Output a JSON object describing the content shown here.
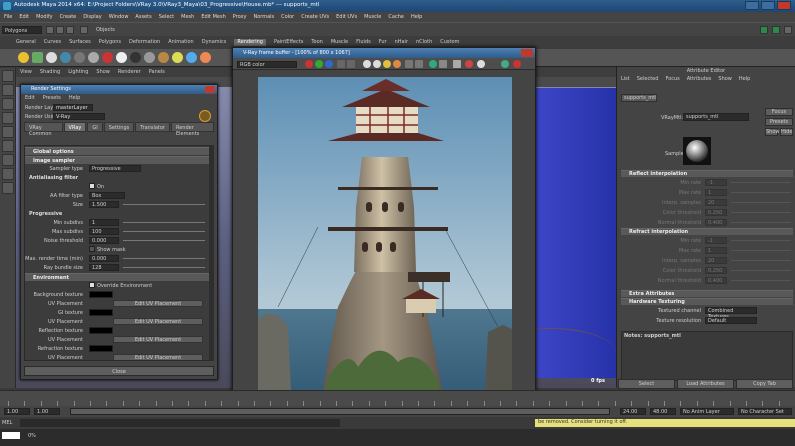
{
  "window": {
    "title": "Autodesk Maya 2014 x64: E:\\Project Folders\\VRay 3.0\\VRay3_Maya\\03_Progressive\\House.mb*  ---  supports_mtl"
  },
  "menubar": [
    "File",
    "Edit",
    "Modify",
    "Create",
    "Display",
    "Window",
    "Assets",
    "Select",
    "Mesh",
    "Edit Mesh",
    "Proxy",
    "Normals",
    "Color",
    "Create UVs",
    "Edit UVs",
    "Muscle",
    "Cache",
    "Help"
  ],
  "statusline": {
    "mode": "Polygons",
    "objects_label": "Objects"
  },
  "shelf_tabs": [
    "General",
    "Curves",
    "Surfaces",
    "Polygons",
    "Deformation",
    "Animation",
    "Dynamics",
    "Rendering",
    "PaintEffects",
    "Toon",
    "Muscle",
    "Fluids",
    "Fur",
    "nHair",
    "nCloth",
    "Custom"
  ],
  "shelf_active_tab": "Rendering",
  "viewport": {
    "menu": [
      "View",
      "Shading",
      "Lighting",
      "Show",
      "Renderer",
      "Panels"
    ],
    "fps": "0 fps"
  },
  "render_settings": {
    "title": "Render Settings",
    "menu": [
      "Edit",
      "Presets",
      "Help"
    ],
    "render_layer_label": "Render Layer",
    "render_layer_value": "masterLayer",
    "render_using_label": "Render Using",
    "render_using_value": "V-Ray",
    "tabs": [
      "VRay Common",
      "VRay",
      "GI",
      "Settings",
      "Translator",
      "Render Elements"
    ],
    "active_tab": "VRay",
    "sections": {
      "global": "Global options",
      "image_sampler": "Image sampler",
      "environment": "Environment"
    },
    "sampler_type_label": "Sampler type",
    "sampler_type_value": "Progressive",
    "aa_filter_heading": "Antialiasing filter",
    "aa_on_label": "On",
    "aa_filter_type_label": "AA filter type",
    "aa_filter_type_value": "Box",
    "size_label": "Size",
    "size_value": "1.500",
    "progressive_heading": "Progressive",
    "min_subdivs_label": "Min subdivs",
    "min_subdivs_value": "1",
    "max_subdivs_label": "Max subdivs",
    "max_subdivs_value": "100",
    "noise_threshold_label": "Noise threshold",
    "noise_threshold_value": "0.000",
    "show_mask_label": "Show mask",
    "max_render_time_label": "Max. render time (min)",
    "max_render_time_value": "0.000",
    "ray_bundle_label": "Ray bundle size",
    "ray_bundle_value": "128",
    "override_env_label": "Override Environment",
    "background_texture_label": "Background texture",
    "uv_placement_label": "UV Placement",
    "gi_texture_label": "GI texture",
    "reflection_texture_label": "Reflection texture",
    "refraction_texture_label": "Refraction texture",
    "edit_uv_button": "Edit UV Placement",
    "close_button": "Close"
  },
  "frame_buffer": {
    "title": "V-Ray frame buffer - [100% of 800 x 1067]",
    "channel": "RGB color"
  },
  "attribute_editor": {
    "header": "Attribute Editor",
    "menu": [
      "List",
      "Selected",
      "Focus",
      "Attributes",
      "Show",
      "Help"
    ],
    "node_tab": "supports_mtl",
    "vraymtl_label": "VRayMtl:",
    "vraymtl_value": "supports_mtl",
    "focus_button": "Focus",
    "presets_button": "Presets",
    "show_button": "Show",
    "hide_button": "Hide",
    "sample_label": "Sample",
    "reflect_interp_section": "Reflect interpolation",
    "refract_interp_section": "Refract interpolation",
    "interp_rows": [
      {
        "label": "Min rate",
        "value": "-1"
      },
      {
        "label": "Max rate",
        "value": "1"
      },
      {
        "label": "Interp. samples",
        "value": "20"
      },
      {
        "label": "Color threshold",
        "value": "0.250"
      },
      {
        "label": "Normal threshold",
        "value": "0.400"
      }
    ],
    "extra_attributes_section": "Extra Attributes",
    "hardware_texturing_section": "Hardware Texturing",
    "textured_channel_label": "Textured channel",
    "textured_channel_value": "Combined Textures",
    "texture_resolution_label": "Texture resolution",
    "texture_resolution_value": "Default",
    "notes_label": "Notes:  supports_mtl",
    "bottom_buttons": [
      "Select",
      "Load Attributes",
      "Copy Tab"
    ]
  },
  "timeline": {
    "start": "1.00",
    "end": "24.00",
    "range_end": "48.00",
    "current": "1.00",
    "anim_layer": "No Anim Layer",
    "char_set": "No Character Set"
  },
  "command_line": {
    "label": "MEL",
    "warning": "be removed. Consider turning it off."
  },
  "help_line": {
    "progress": "0%"
  }
}
